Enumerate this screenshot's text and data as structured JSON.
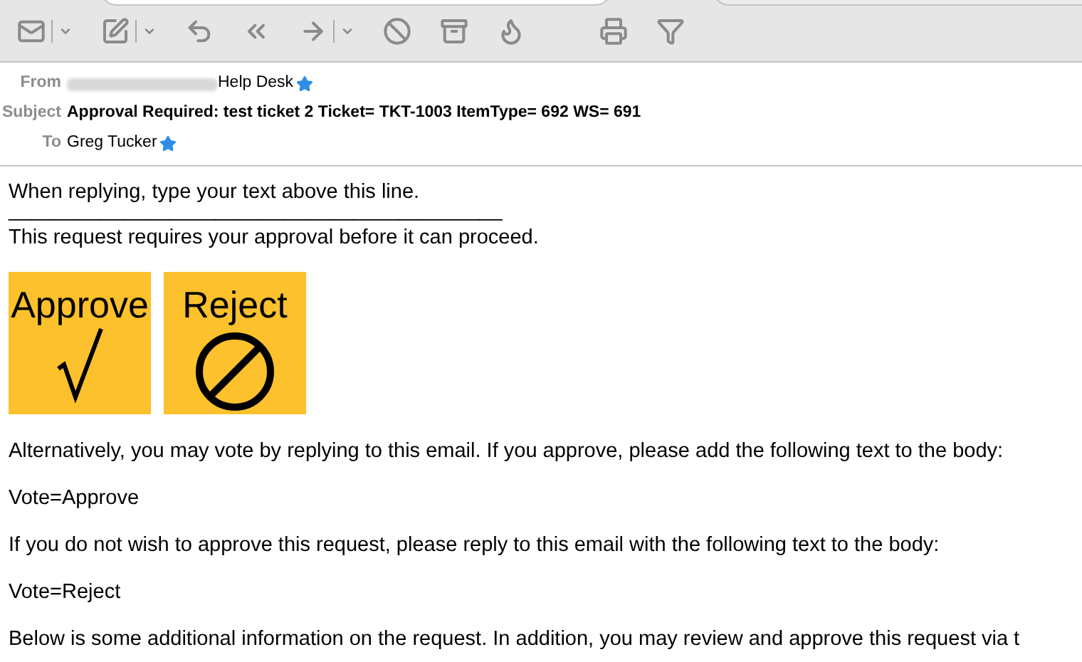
{
  "toolbar": {
    "buttons": [
      {
        "kind": "mail",
        "menu": true
      },
      {
        "kind": "compose",
        "menu": true
      },
      {
        "kind": "reply",
        "menu": false
      },
      {
        "kind": "reply_all",
        "menu": false
      },
      {
        "kind": "forward",
        "menu": true
      },
      {
        "kind": "junk",
        "menu": false
      },
      {
        "kind": "archive",
        "menu": false
      },
      {
        "kind": "flame",
        "menu": false
      },
      {
        "kind": "print",
        "menu": false
      },
      {
        "kind": "filter",
        "menu": false
      }
    ]
  },
  "header": {
    "fields": [
      {
        "label": "From",
        "value": "Help Desk",
        "redacted": true,
        "starred": true,
        "bold": false
      },
      {
        "label": "Subject",
        "value": "Approval Required: test ticket 2 Ticket= TKT-1003 ItemType= 692 WS= 691",
        "redacted": false,
        "starred": false,
        "bold": true
      },
      {
        "label": "To",
        "value": "Greg Tucker",
        "redacted": false,
        "starred": true,
        "bold": false
      }
    ]
  },
  "body": {
    "intro": "When replying, type your text above this line.",
    "rule": "___________________________________________",
    "lead": "This request requires your approval before it can proceed.",
    "actions": [
      {
        "kind": "approve",
        "label": "Approve"
      },
      {
        "kind": "reject",
        "label": "Reject"
      }
    ],
    "paragraphs": [
      "Alternatively, you may vote by replying to this email. If you approve, please add the following text to the body:",
      "Vote=Approve",
      "If you do not wish to approve this request, please reply to this email with the following text to the body:",
      "Vote=Reject",
      "Below is some additional information on the request. In addition, you may review and approve this request via t"
    ]
  }
}
